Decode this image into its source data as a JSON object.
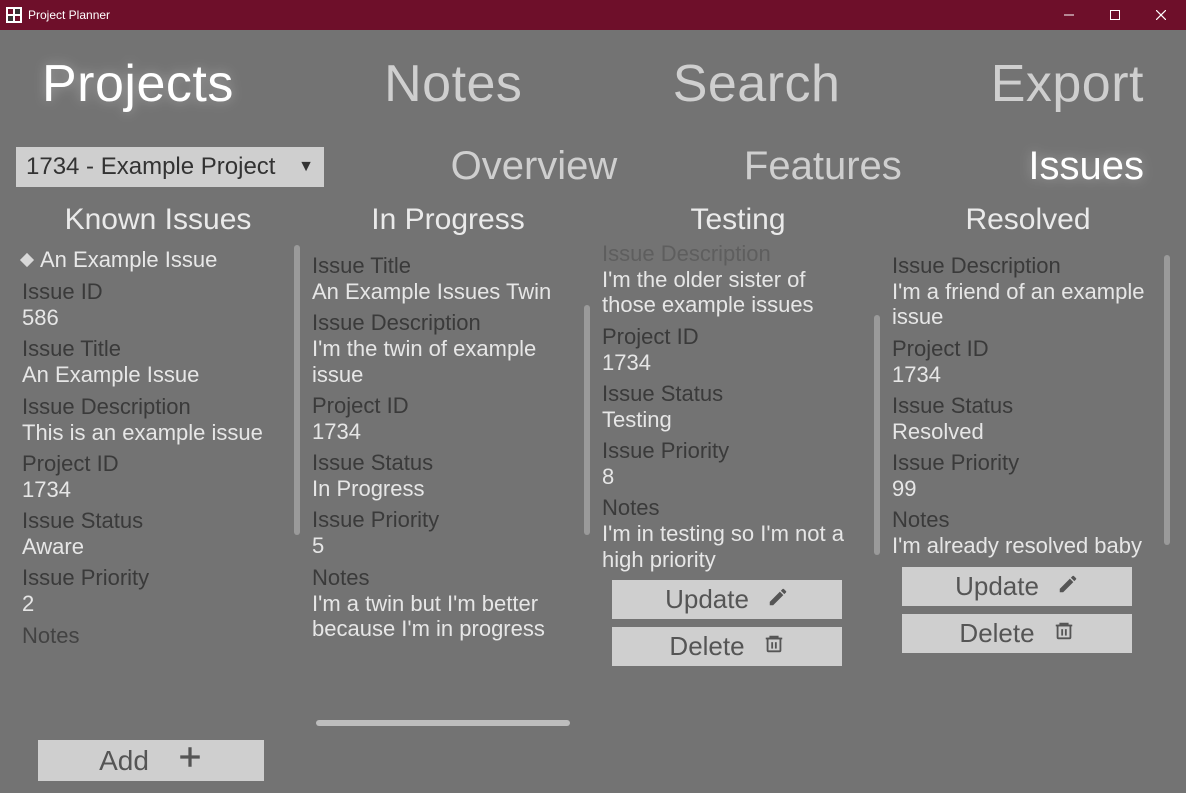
{
  "window": {
    "title": "Project Planner"
  },
  "topnav": {
    "items": [
      {
        "label": "Projects",
        "active": true
      },
      {
        "label": "Notes",
        "active": false
      },
      {
        "label": "Search",
        "active": false
      },
      {
        "label": "Export",
        "active": false
      }
    ]
  },
  "subnav": {
    "project_selected": "1734 - Example Project",
    "items": [
      {
        "label": "Overview",
        "active": false
      },
      {
        "label": "Features",
        "active": false
      },
      {
        "label": "Issues",
        "active": true
      }
    ]
  },
  "columns": {
    "known": {
      "title": "Known Issues",
      "bullet": "An Example Issue",
      "fields": {
        "id_label": "Issue ID",
        "id": "586",
        "title_label": "Issue Title",
        "title": "An Example Issue",
        "desc_label": "Issue Description",
        "desc": "This is an example issue",
        "proj_label": "Project ID",
        "proj": "1734",
        "status_label": "Issue Status",
        "status": "Aware",
        "prio_label": "Issue Priority",
        "prio": "2",
        "notes_label": "Notes"
      }
    },
    "inprogress": {
      "title": "In Progress",
      "fields": {
        "title_label": "Issue Title",
        "title": "An Example Issues Twin",
        "desc_label": "Issue Description",
        "desc": "I'm the twin of example issue",
        "proj_label": "Project ID",
        "proj": "1734",
        "status_label": "Issue Status",
        "status": "In Progress",
        "prio_label": "Issue Priority",
        "prio": "5",
        "notes_label": "Notes",
        "notes": "I'm a twin but I'm better because I'm in progress"
      }
    },
    "testing": {
      "title": "Testing",
      "fields": {
        "desc_label_cut": "Issue Description",
        "desc": "I'm the older sister of those example issues",
        "proj_label": "Project ID",
        "proj": "1734",
        "status_label": "Issue Status",
        "status": "Testing",
        "prio_label": "Issue Priority",
        "prio": "8",
        "notes_label": "Notes",
        "notes": "I'm in testing so I'm not a high priority"
      }
    },
    "resolved": {
      "title": "Resolved",
      "fields": {
        "desc_label": "Issue Description",
        "desc": "I'm a friend of an example issue",
        "proj_label": "Project ID",
        "proj": "1734",
        "status_label": "Issue Status",
        "status": "Resolved",
        "prio_label": "Issue Priority",
        "prio": "99",
        "notes_label": "Notes",
        "notes": "I'm already resolved baby"
      }
    }
  },
  "buttons": {
    "update": "Update",
    "delete": "Delete",
    "add": "Add"
  }
}
